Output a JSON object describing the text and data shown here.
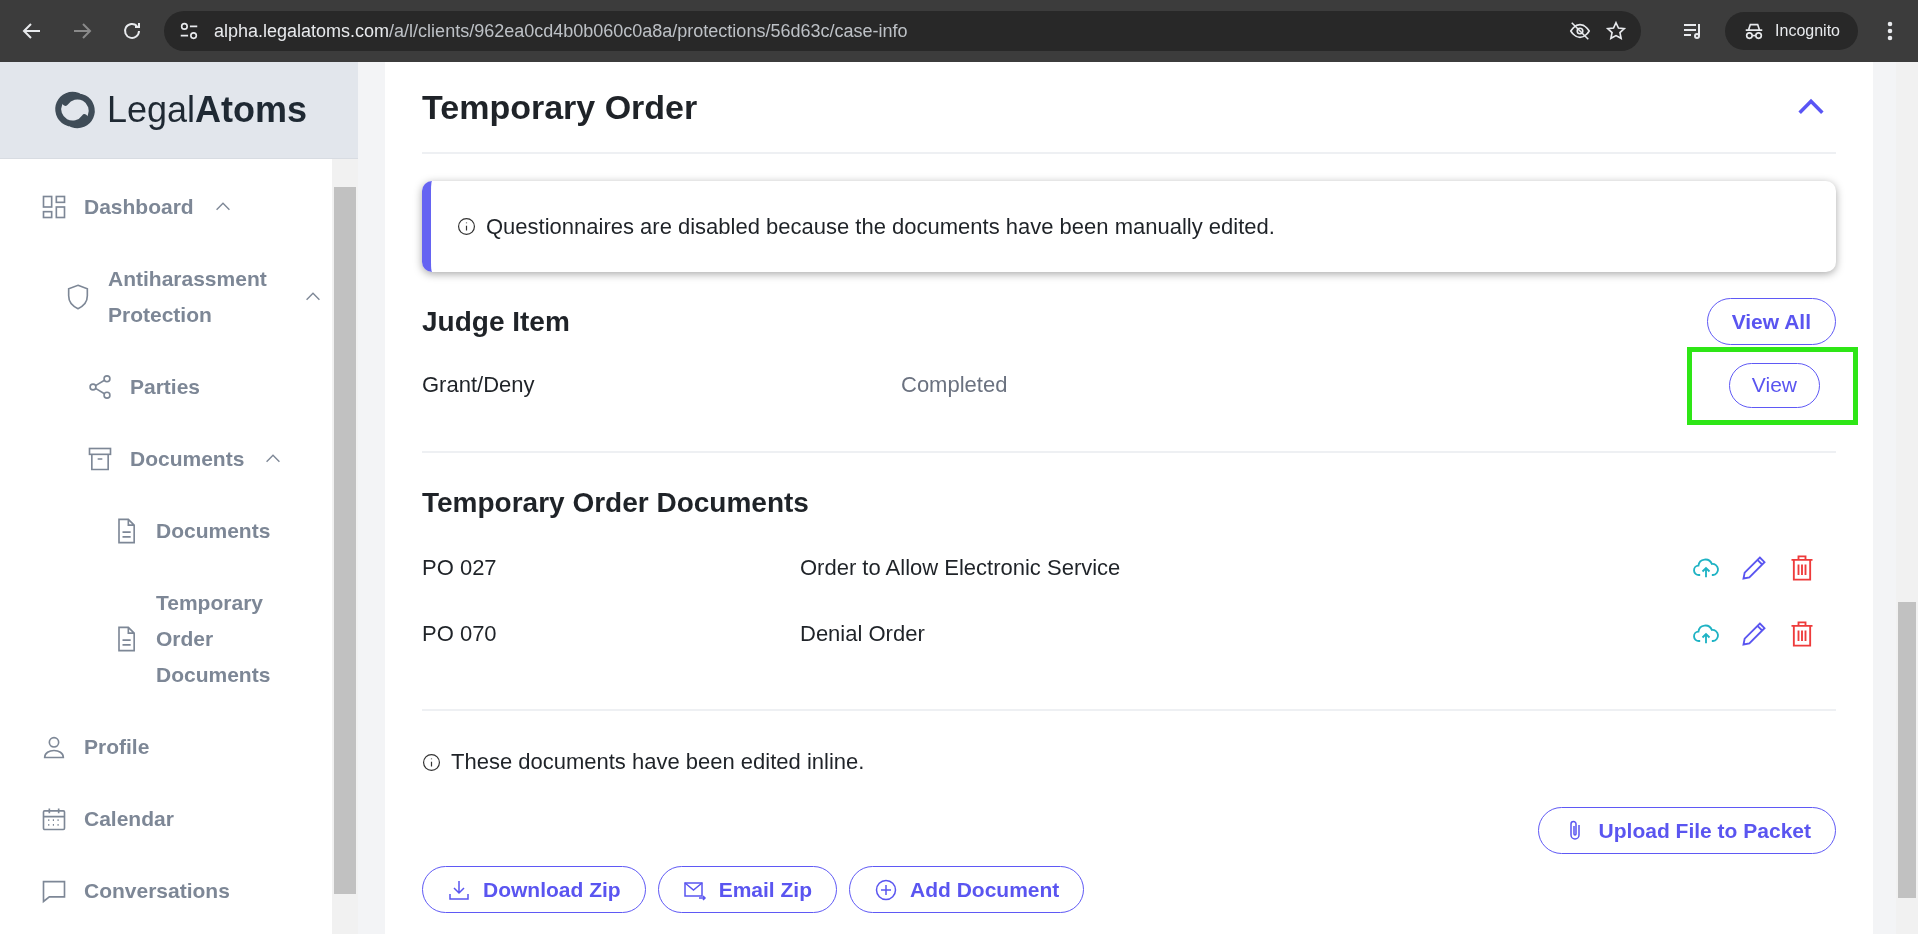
{
  "browser": {
    "url_host": "alpha.legalatoms.com",
    "url_path": "/a/l/clients/962ea0cd4b0b060c0a8a/protections/56d63c/case-info",
    "profile": "Incognito"
  },
  "sidebar": {
    "logo_light": "Legal",
    "logo_bold": "Atoms",
    "items": [
      {
        "label": "Dashboard",
        "kind": "grid",
        "expanded": true,
        "children": [
          {
            "label": "Antiharassment Protection",
            "kind": "shield",
            "expanded": true,
            "children": [
              {
                "label": "Parties",
                "kind": "share"
              },
              {
                "label": "Documents",
                "kind": "archive",
                "expanded": true,
                "children": [
                  {
                    "label": "Documents",
                    "kind": "file"
                  },
                  {
                    "label": "Temporary Order Documents",
                    "kind": "file"
                  }
                ]
              }
            ]
          }
        ]
      },
      {
        "label": "Profile",
        "kind": "user"
      },
      {
        "label": "Calendar",
        "kind": "calendar"
      },
      {
        "label": "Conversations",
        "kind": "chat"
      }
    ]
  },
  "section": {
    "title": "Temporary Order",
    "expanded": true,
    "notice": "Questionnaires are disabled because the documents have been manually edited.",
    "judge": {
      "heading": "Judge Item",
      "view_all": "View All",
      "rows": [
        {
          "name": "Grant/Deny",
          "status": "Completed",
          "button": "View",
          "highlighted": true
        }
      ]
    },
    "documents": {
      "heading": "Temporary Order Documents",
      "rows": [
        {
          "code": "PO 027",
          "title": "Order to Allow Electronic Service"
        },
        {
          "code": "PO 070",
          "title": "Denial Order"
        }
      ],
      "note": "These documents have been edited inline.",
      "upload": "Upload File to Packet",
      "buttons": [
        {
          "label": "Download Zip",
          "kind": "download"
        },
        {
          "label": "Email Zip",
          "kind": "email"
        },
        {
          "label": "Add Document",
          "kind": "add"
        }
      ]
    }
  }
}
